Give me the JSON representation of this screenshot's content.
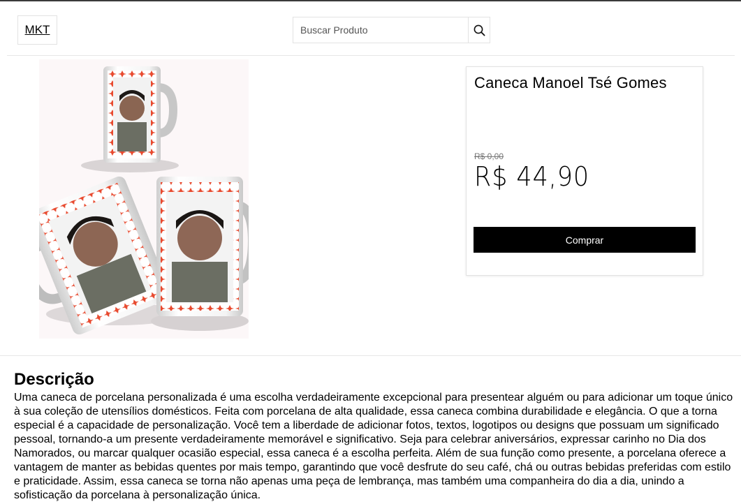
{
  "header": {
    "logo": "MKT",
    "search_placeholder": "Buscar Produto",
    "search_icon": "search-icon"
  },
  "product": {
    "title": "Caneca Manoel Tsé Gomes",
    "old_price": "R$ 0,00",
    "price": "R$ 44,90",
    "buy_label": "Comprar",
    "image": "mug-photo"
  },
  "description": {
    "heading": "Descrição",
    "text": "Uma caneca de porcelana personalizada é uma escolha verdadeiramente excepcional para presentear alguém ou para adicionar um toque único à sua coleção de utensílios domésticos. Feita com porcelana de alta qualidade, essa caneca combina durabilidade e elegância. O que a torna especial é a capacidade de personalização. Você tem a liberdade de adicionar fotos, textos, logotipos ou designs que possuam um significado pessoal, tornando-a um presente verdadeiramente memorável e significativo. Seja para celebrar aniversários, expressar carinho no Dia dos Namorados, ou marcar qualquer ocasião especial, essa caneca é a escolha perfeita. Além de sua função como presente, a porcelana oferece a vantagem de manter as bebidas quentes por mais tempo, garantindo que você desfrute do seu café, chá ou outras bebidas preferidas com estilo e praticidade. Assim, essa caneca se torna não apenas uma peça de lembrança, mas também uma companheira do dia a dia, unindo a sofisticação da porcelana à personalização única."
  },
  "colors": {
    "buy_button_bg": "#000000",
    "buy_button_text": "#ffffff",
    "mug_pattern": "#e84a2f"
  }
}
